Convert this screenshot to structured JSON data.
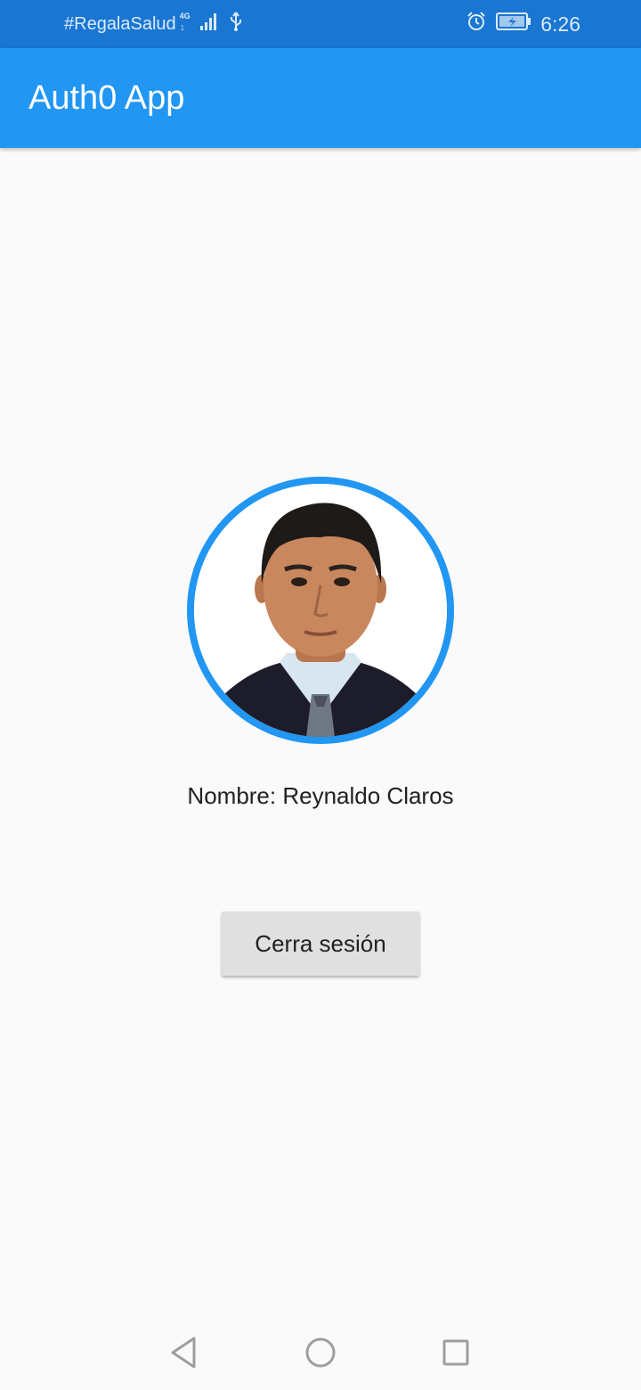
{
  "status_bar": {
    "carrier": "#RegalaSalud",
    "network_type": "4G",
    "network_sub": "1",
    "time": "6:26",
    "icons": [
      "signal-icon",
      "usb-icon",
      "alarm-icon",
      "battery-charging-icon"
    ]
  },
  "app_bar": {
    "title": "Auth0 App",
    "color": "#2196f3"
  },
  "profile": {
    "avatar_alt": "profile-photo",
    "name_line": "Nombre: Reynaldo Claros",
    "ring_color": "#2196f3"
  },
  "actions": {
    "logout_label": "Cerra sesión"
  },
  "nav_bar": {
    "icons": [
      "back-icon",
      "home-icon",
      "recent-apps-icon"
    ]
  }
}
